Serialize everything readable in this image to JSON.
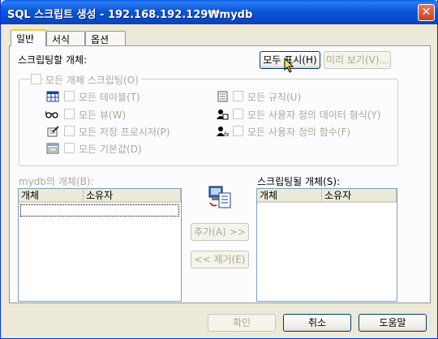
{
  "window": {
    "title": "SQL 스크립트 생성 - 192.168.192.129₩mydb"
  },
  "tabs": [
    {
      "label": "일반",
      "active": true
    },
    {
      "label": "서식",
      "active": false
    },
    {
      "label": "옵션",
      "active": false
    }
  ],
  "objects_label": "스크립팅할 개체:",
  "show_all_button": "모두 표시(H)",
  "preview_button": "미리 보기(V)...",
  "all_objects": {
    "label": "모든 개체 스크립팅(O)"
  },
  "object_types": [
    {
      "label": "모든 테이블(T)",
      "icon": "table-icon"
    },
    {
      "label": "모든 뷰(W)",
      "icon": "glasses-icon"
    },
    {
      "label": "모든 저장 프로시저(P)",
      "icon": "stored-procedure-icon"
    },
    {
      "label": "모든 기본값(D)",
      "icon": "default-icon"
    },
    {
      "label": "모든 규칙(U)",
      "icon": "rule-icon"
    },
    {
      "label": "모든 사용자 정의 데이터 형식(Y)",
      "icon": "user-defined-type-icon"
    },
    {
      "label": "모든 사용자 정의 함수(F)",
      "icon": "user-defined-function-icon"
    }
  ],
  "source_list": {
    "label": "mydb의 개체(B):",
    "columns": [
      "개체",
      "소유자"
    ]
  },
  "target_list": {
    "label": "스크립팅될 개체(S):",
    "columns": [
      "개체",
      "소유자"
    ]
  },
  "add_button": "추가(A) >>",
  "remove_button": "<< 제거(E)",
  "footer": {
    "ok": "확인",
    "cancel": "취소",
    "help": "도움말"
  },
  "colors": {
    "titlebar": "#0a57d6",
    "disabled_text": "#aca899",
    "active_tab_accent": "#ffc83c"
  }
}
